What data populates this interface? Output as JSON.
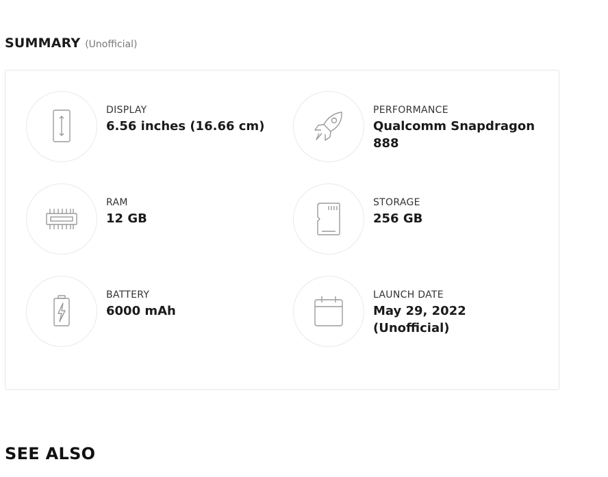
{
  "summary": {
    "title": "SUMMARY",
    "subtitle": "(Unofficial)"
  },
  "specs": [
    {
      "label": "DISPLAY",
      "value": "6.56 inches (16.66 cm)",
      "icon": "display-icon"
    },
    {
      "label": "PERFORMANCE",
      "value": "Qualcomm Snapdragon 888",
      "icon": "rocket-icon"
    },
    {
      "label": "RAM",
      "value": "12 GB",
      "icon": "chip-icon"
    },
    {
      "label": "STORAGE",
      "value": "256 GB",
      "icon": "sd-card-icon"
    },
    {
      "label": "BATTERY",
      "value": "6000 mAh",
      "icon": "battery-icon"
    },
    {
      "label": "LAUNCH DATE",
      "value": "May 29, 2022 (Unofficial)",
      "icon": "calendar-icon"
    }
  ],
  "see_also": {
    "title": "SEE ALSO"
  },
  "colors": {
    "icon_stroke": "#9a9a9a",
    "border": "#e6e6e6"
  }
}
